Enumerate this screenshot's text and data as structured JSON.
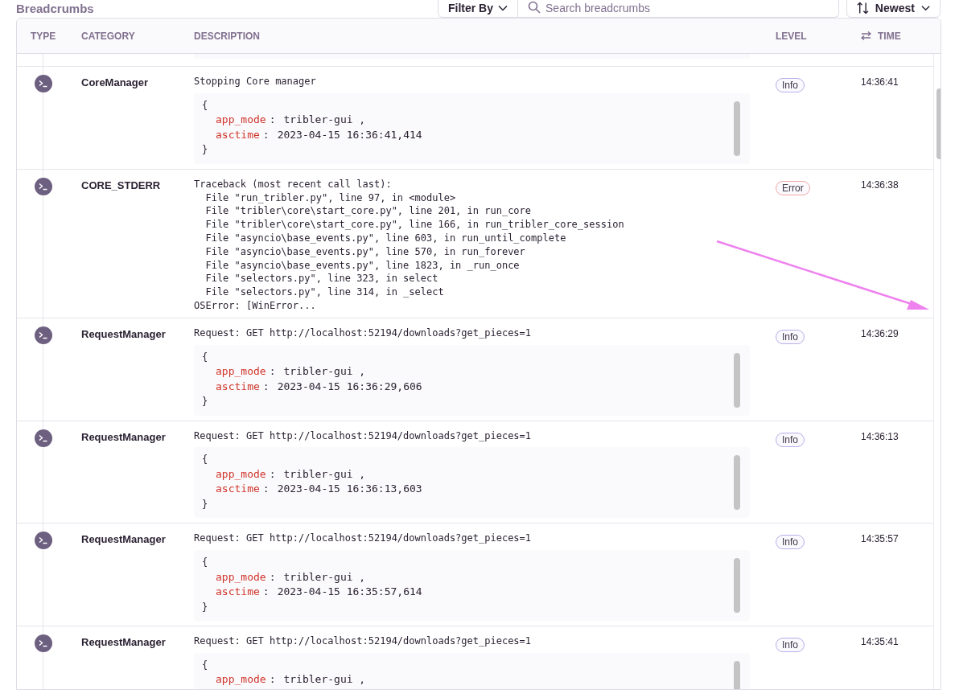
{
  "title": "Breadcrumbs",
  "filter": {
    "label": "Filter By"
  },
  "search": {
    "placeholder": "Search breadcrumbs"
  },
  "sort": {
    "label": "Newest"
  },
  "table": {
    "columns": [
      "TYPE",
      "CATEGORY",
      "DESCRIPTION",
      "LEVEL",
      "TIME"
    ],
    "rows": [
      {
        "category": "CoreManager",
        "message": "Stopping Core manager",
        "data": {
          "open": "{",
          "entries": [
            {
              "key": "app_mode",
              "separator": ":",
              "value": "tribler-gui ,"
            },
            {
              "key": "asctime",
              "separator": ":",
              "value": "2023-04-15 16:36:41,414"
            }
          ],
          "close": "}"
        },
        "level": "Info",
        "color": "#b9aee8",
        "time": "14:36:41"
      },
      {
        "category": "CORE_STDERR",
        "message": "Traceback (most recent call last):\n  File \"run_tribler.py\", line 97, in <module>\n  File \"tribler\\core\\start_core.py\", line 201, in run_core\n  File \"tribler\\core\\start_core.py\", line 166, in run_tribler_core_session\n  File \"asyncio\\base_events.py\", line 603, in run_until_complete\n  File \"asyncio\\base_events.py\", line 570, in run_forever\n  File \"asyncio\\base_events.py\", line 1823, in _run_once\n  File \"selectors.py\", line 323, in select\n  File \"selectors.py\", line 314, in _select\nOSError: [WinError...",
        "level": "Error",
        "color": "#f2a8a8",
        "time": "14:36:38"
      },
      {
        "category": "RequestManager",
        "message": "Request: GET http://localhost:52194/downloads?get_pieces=1",
        "data": {
          "open": "{",
          "entries": [
            {
              "key": "app_mode",
              "separator": ":",
              "value": "tribler-gui ,"
            },
            {
              "key": "asctime",
              "separator": ":",
              "value": "2023-04-15 16:36:29,606"
            }
          ],
          "close": "}"
        },
        "level": "Info",
        "color": "#b9aee8",
        "time": "14:36:29"
      },
      {
        "category": "RequestManager",
        "message": "Request: GET http://localhost:52194/downloads?get_pieces=1",
        "data": {
          "open": "{",
          "entries": [
            {
              "key": "app_mode",
              "separator": ":",
              "value": "tribler-gui ,"
            },
            {
              "key": "asctime",
              "separator": ":",
              "value": "2023-04-15 16:36:13,603"
            }
          ],
          "close": "}"
        },
        "level": "Info",
        "color": "#b9aee8",
        "time": "14:36:13"
      },
      {
        "category": "RequestManager",
        "message": "Request: GET http://localhost:52194/downloads?get_pieces=1",
        "data": {
          "open": "{",
          "entries": [
            {
              "key": "app_mode",
              "separator": ":",
              "value": "tribler-gui ,"
            },
            {
              "key": "asctime",
              "separator": ":",
              "value": "2023-04-15 16:35:57,614"
            }
          ],
          "close": "}"
        },
        "level": "Info",
        "color": "#b9aee8",
        "time": "14:35:57"
      },
      {
        "category": "RequestManager",
        "message": "Request: GET http://localhost:52194/downloads?get_pieces=1",
        "data": {
          "open": "{",
          "entries": [
            {
              "key": "app_mode",
              "separator": ":",
              "value": "tribler-gui ,"
            }
          ]
        },
        "level": "Info",
        "color": "#b9aee8",
        "time": "14:35:41"
      }
    ]
  }
}
